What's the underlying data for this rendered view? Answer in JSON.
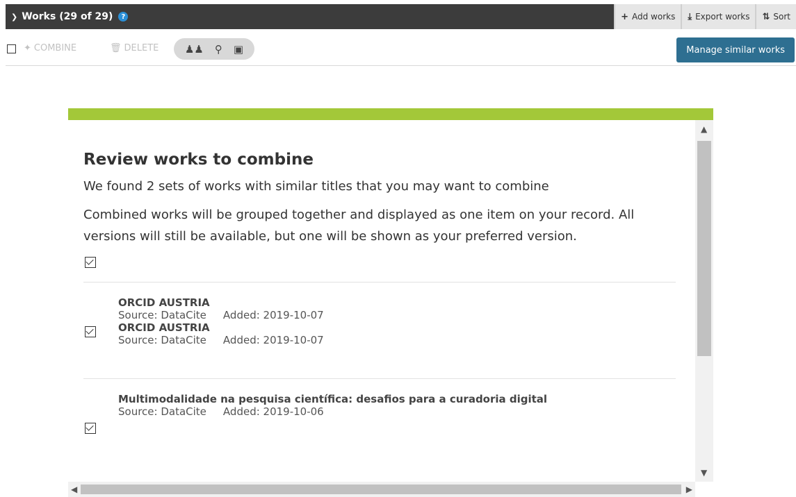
{
  "header": {
    "title": "Works (29 of 29)",
    "help": "?",
    "actions": [
      {
        "icon": "plus-icon",
        "glyph": "+",
        "label": "Add works"
      },
      {
        "icon": "download-icon",
        "glyph": "⤓",
        "label": "Export works"
      },
      {
        "icon": "sort-icon",
        "glyph": "⇅",
        "label": "Sort"
      }
    ]
  },
  "toolbar": {
    "combine": "COMBINE",
    "delete": "DELETE",
    "manage": "Manage similar works",
    "visibility_icons": [
      "group-icon",
      "key-icon",
      "lock-icon"
    ]
  },
  "modal": {
    "title": "Review works to combine",
    "intro": "We found 2 sets of works with similar titles that you may want to combine",
    "body": "Combined works will be grouped together and displayed as one item on your record. All versions will still be available, but one will be shown as your preferred version.",
    "groups": [
      {
        "items": [
          {
            "title": "ORCID AUSTRIA",
            "source": "Source: DataCite",
            "added": "Added: 2019-10-07"
          },
          {
            "title": "ORCID AUSTRIA",
            "source": "Source: DataCite",
            "added": "Added: 2019-10-07"
          }
        ]
      },
      {
        "items": [
          {
            "title": "Multimodalidade na pesquisa científica: desafios para a curadoria digital",
            "source": "Source: DataCite",
            "added": "Added: 2019-10-06"
          }
        ]
      }
    ]
  },
  "colors": {
    "header_bg": "#3c3c3c",
    "modal_accent": "#a3c839",
    "manage_button": "#2e6f91",
    "help_badge": "#2b8fd6"
  }
}
